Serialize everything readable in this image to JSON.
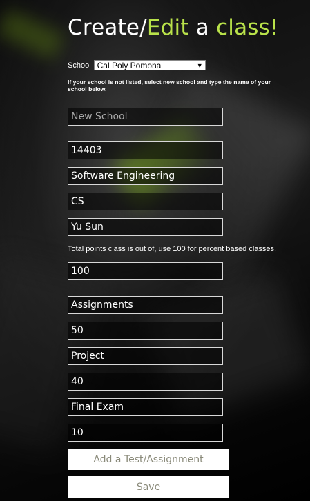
{
  "header": {
    "title_part1": "Create/",
    "title_part2": "Edit",
    "title_part3": " a ",
    "title_part4": "class!"
  },
  "school": {
    "label": "School",
    "selected": "Cal Poly Pomona",
    "note": "If your school is not listed, select new school and type the name of your school below.",
    "new_school_placeholder": "New School"
  },
  "class_info": {
    "class_number": "14403",
    "class_name": "Software Engineering",
    "department": "CS",
    "instructor": "Yu Sun"
  },
  "points": {
    "note": "Total points class is out of, use 100 for percent based classes.",
    "total": "100"
  },
  "assignments": [
    {
      "name": "Assignments",
      "weight": "50"
    },
    {
      "name": "Project",
      "weight": "40"
    },
    {
      "name": "Final Exam",
      "weight": "10"
    }
  ],
  "buttons": {
    "add_label": "Add a Test/Assignment",
    "save_label": "Save"
  },
  "colors": {
    "accent": "#b9e24a",
    "text": "#ffffff",
    "button_text": "#8a8a7a"
  }
}
